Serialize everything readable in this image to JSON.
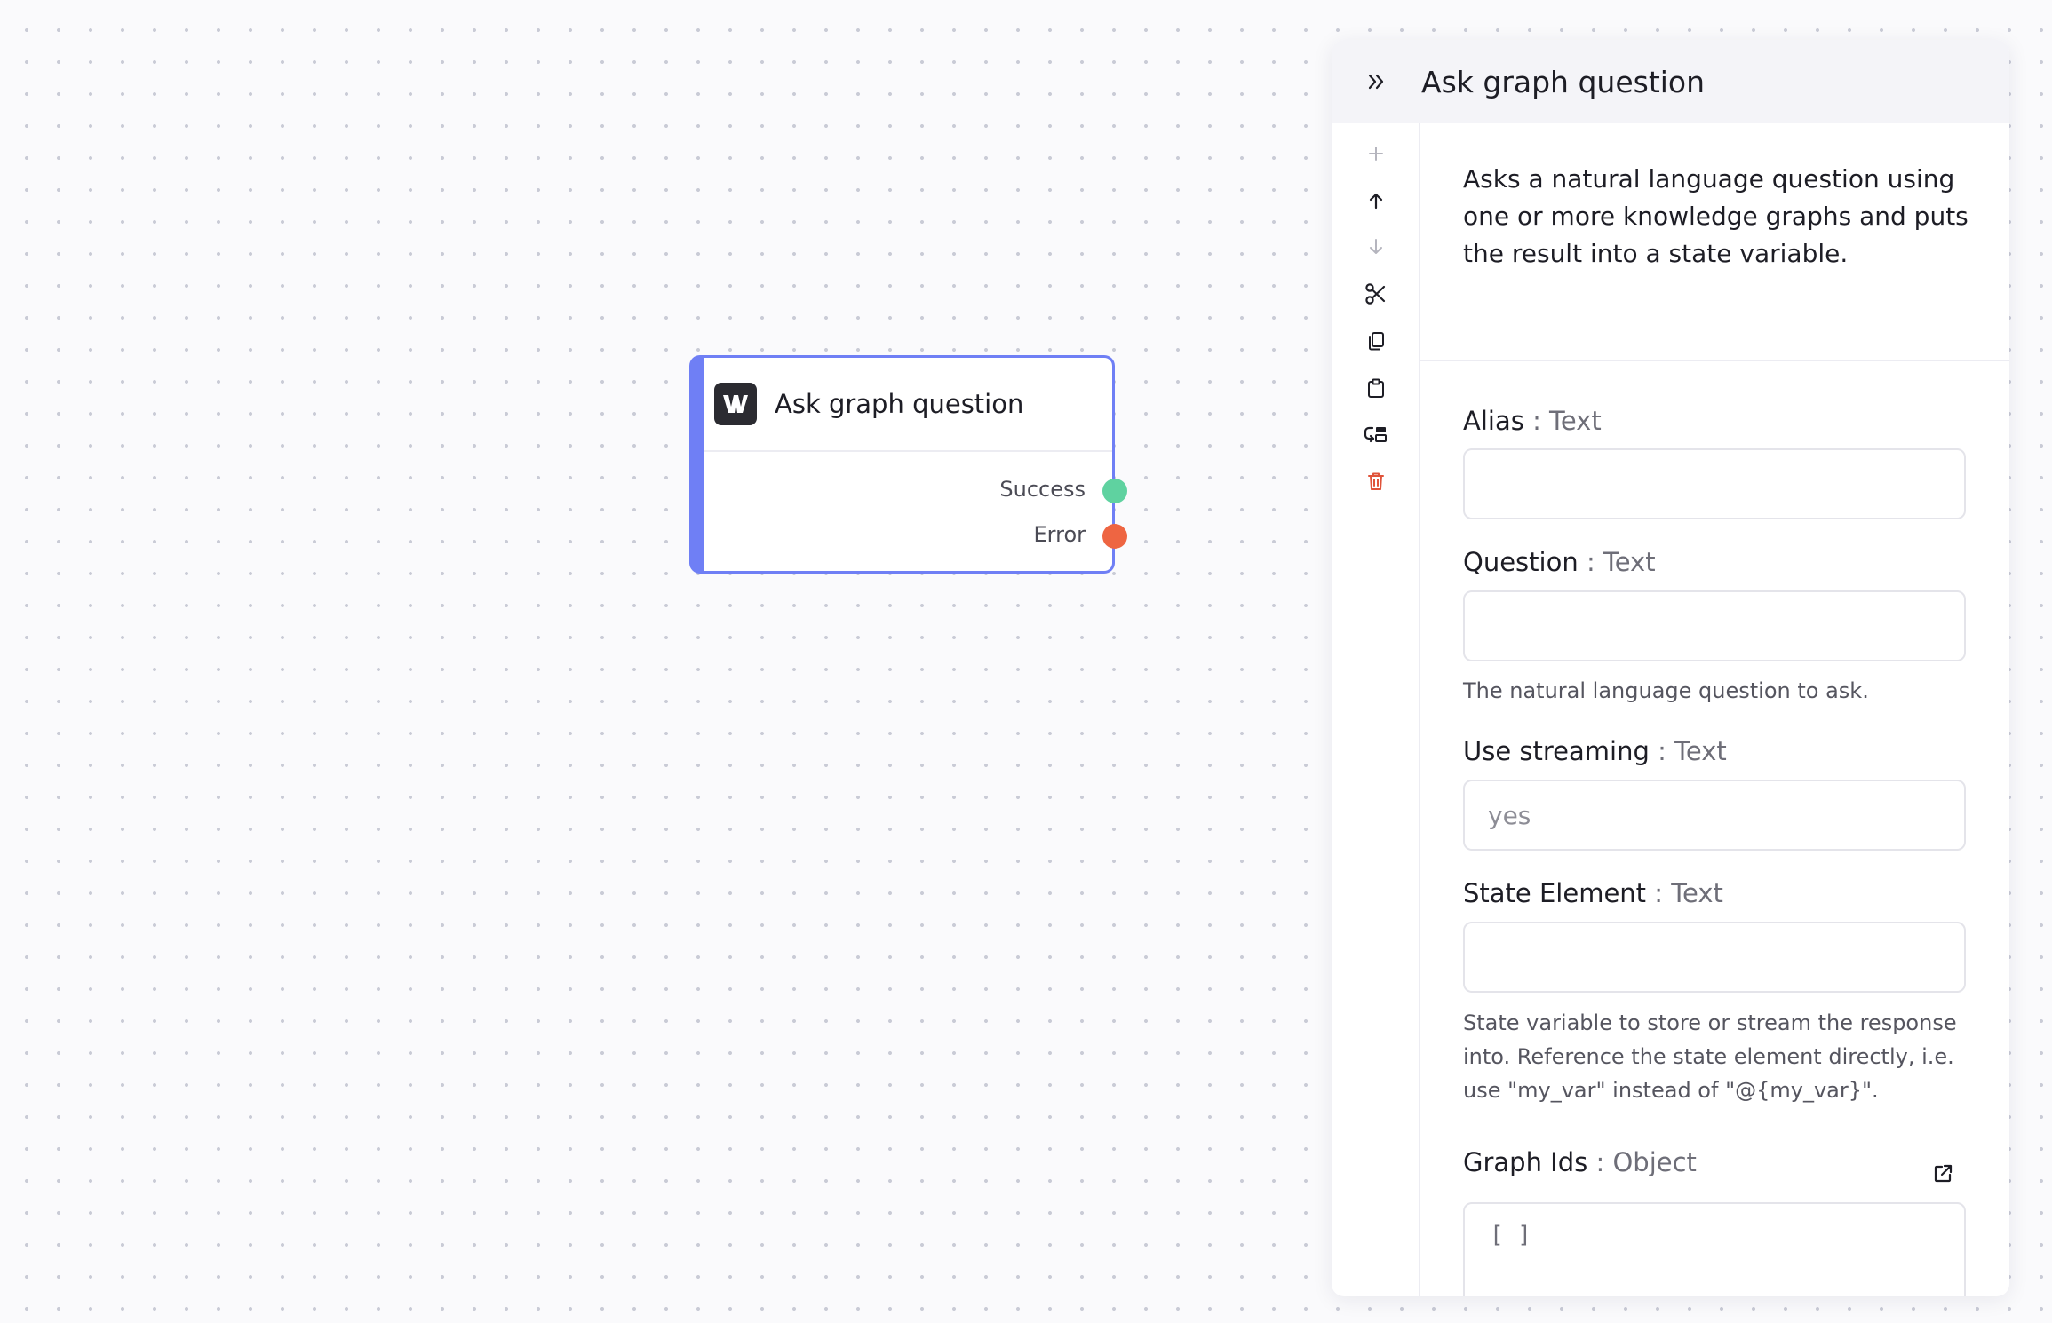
{
  "node": {
    "title": "Ask graph question",
    "logo_icon": "workflow-logo-icon",
    "outputs": [
      {
        "label": "Success",
        "color": "#5fd2a0"
      },
      {
        "label": "Error",
        "color": "#ee6542"
      }
    ],
    "accent_color": "#6f7ff5"
  },
  "panel": {
    "collapse_icon": "chevrons-right-icon",
    "title": "Ask graph question",
    "description": "Asks a natural language question using one or more knowledge graphs and puts the result into a state variable.",
    "toolbar": [
      {
        "icon": "plus-icon",
        "label": "Add"
      },
      {
        "icon": "arrow-up-icon",
        "label": "Move up"
      },
      {
        "icon": "arrow-down-icon",
        "label": "Move down"
      },
      {
        "icon": "scissors-icon",
        "label": "Cut"
      },
      {
        "icon": "copy-icon",
        "label": "Copy"
      },
      {
        "icon": "clipboard-icon",
        "label": "Paste"
      },
      {
        "icon": "go-to-parent-icon",
        "label": "Go to parent"
      },
      {
        "icon": "trash-icon",
        "label": "Delete"
      }
    ],
    "fields": {
      "alias": {
        "label": "Alias",
        "type": ": Text",
        "value": ""
      },
      "question": {
        "label": "Question",
        "type": ": Text",
        "value": "",
        "help": "The natural language question to ask."
      },
      "use_streaming": {
        "label": "Use streaming",
        "type": ": Text",
        "placeholder": "yes"
      },
      "state_element": {
        "label": "State Element",
        "type": ": Text",
        "value": "",
        "help": "State variable to store or stream the response into. Reference the state element directly, i.e. use \"my_var\" instead of \"@{my_var}\"."
      },
      "graph_ids": {
        "label": "Graph Ids",
        "type": ": Object",
        "value": "[ ]",
        "open_icon": "open-external-icon"
      }
    },
    "colors": {
      "delete": "#e0533a",
      "muted_icon": "#b5b5be"
    }
  }
}
